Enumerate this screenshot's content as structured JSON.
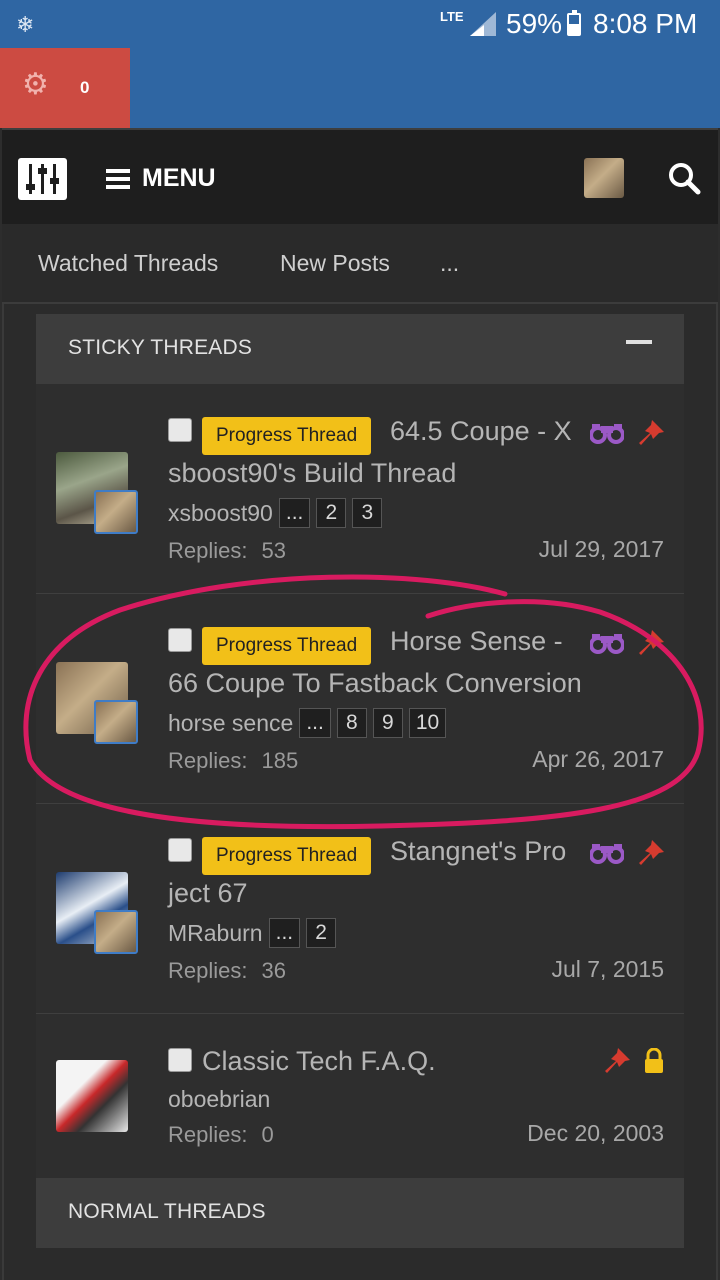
{
  "status_bar": {
    "network": "LTE",
    "battery": "59%",
    "time": "8:08 PM"
  },
  "notifications": {
    "count": "0"
  },
  "navbar": {
    "menu_label": "MENU",
    "icons": [
      "logo-icon",
      "hamburger-icon",
      "user-avatar",
      "search-icon"
    ]
  },
  "subnav": {
    "items": [
      "Watched Threads",
      "New Posts",
      "..."
    ]
  },
  "sticky_header": "STICKY THREADS",
  "normal_header": "NORMAL THREADS",
  "threads": [
    {
      "prefix": "Progress Thread",
      "title_line1": "64.5 Coupe - X",
      "title_line2": "sboost90's Build Thread",
      "author": "xsboost90",
      "pages": [
        "...",
        "2",
        "3"
      ],
      "replies_label": "Replies:",
      "replies": "53",
      "date": "Jul 29, 2017"
    },
    {
      "prefix": "Progress Thread",
      "title_line1": "Horse Sense -",
      "title_line2": "66 Coupe To Fastback Conversion",
      "author": "horse sence",
      "pages": [
        "...",
        "8",
        "9",
        "10"
      ],
      "replies_label": "Replies:",
      "replies": "185",
      "date": "Apr 26, 2017"
    },
    {
      "prefix": "Progress Thread",
      "title_line1": "Stangnet's Pro",
      "title_line2": "ject 67",
      "author": "MRaburn",
      "pages": [
        "...",
        "2"
      ],
      "replies_label": "Replies:",
      "replies": "36",
      "date": "Jul 7, 2015"
    },
    {
      "title_line1": "Classic Tech F.A.Q.",
      "author": "oboebrian",
      "replies_label": "Replies:",
      "replies": "0",
      "date": "Dec 20, 2003"
    }
  ],
  "colors": {
    "status_blue": "#2f66a3",
    "alert_red": "#cc4b42",
    "prefix_yellow": "#f2c018",
    "watch_purple": "#9b59c6",
    "pin_red": "#d63b2f",
    "lock_yellow": "#f2c018",
    "highlight_pink": "#d81b60"
  }
}
